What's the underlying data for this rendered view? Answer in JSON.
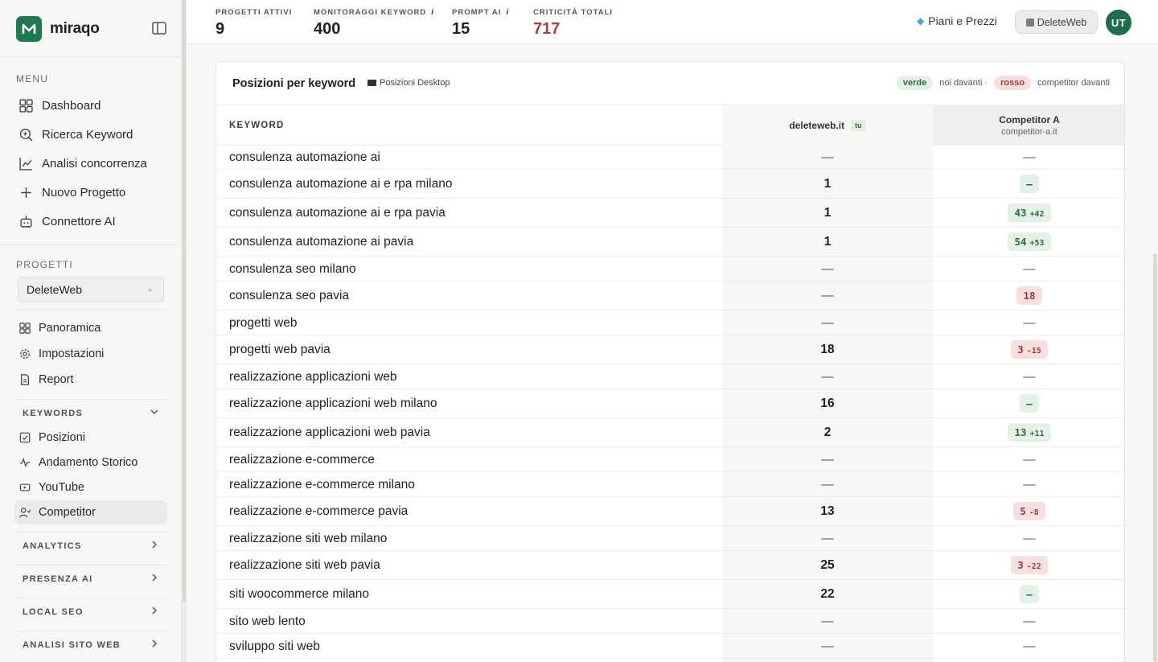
{
  "brand": {
    "name": "miraqo"
  },
  "sidebar": {
    "menu_label": "MENU",
    "menu": [
      {
        "label": "Dashboard",
        "icon": "grid-icon"
      },
      {
        "label": "Ricerca Keyword",
        "icon": "search-icon"
      },
      {
        "label": "Analisi concorrenza",
        "icon": "line-chart-icon"
      },
      {
        "label": "Nuovo Progetto",
        "icon": "plus-icon"
      },
      {
        "label": "Connettore AI",
        "icon": "bot-icon"
      }
    ],
    "projects_label": "PROGETTI",
    "selected_project": "DeleteWeb",
    "project_nav": [
      {
        "label": "Panoramica",
        "icon": "grid-icon"
      },
      {
        "label": "Impostazioni",
        "icon": "gear-icon"
      },
      {
        "label": "Report",
        "icon": "document-icon"
      }
    ],
    "keywords_group": "KEYWORDS",
    "keywords_items": [
      {
        "label": "Posizioni",
        "icon": "checkbox-icon"
      },
      {
        "label": "Andamento Storico",
        "icon": "pulse-icon"
      },
      {
        "label": "YouTube",
        "icon": "youtube-icon"
      },
      {
        "label": "Competitor",
        "icon": "users-icon"
      }
    ],
    "groups": [
      "ANALYTICS",
      "PRESENZA AI",
      "LOCAL SEO",
      "ANALISI SITO WEB"
    ]
  },
  "topbar": {
    "stats": [
      {
        "label": "PROGETTI ATTIVI",
        "value": "9",
        "info": ""
      },
      {
        "label": "MONITORAGGI KEYWORD",
        "value": "400",
        "info": "i"
      },
      {
        "label": "PROMPT AI",
        "value": "15",
        "info": "i"
      },
      {
        "label": "CRITICITÀ TOTALI",
        "value": "717",
        "info": ""
      }
    ],
    "plans_label": "Piani e Prezzi",
    "project_button": "DeleteWeb",
    "avatar_initials": "UT"
  },
  "card": {
    "title": "Posizioni per keyword",
    "desktop_badge": "Posizioni Desktop",
    "legend": {
      "green": "verde",
      "green_text": "noi davanti ·",
      "red": "rosso",
      "red_text": "competitor davanti"
    },
    "columns": {
      "keyword": "KEYWORD",
      "own_domain": "deleteweb.it",
      "own_tag": "tu",
      "competitor_name": "Competitor A",
      "competitor_domain": "competitor-a.it"
    }
  },
  "colors": {
    "accent": "#1d7a4f",
    "green_badge": "#e5f1e7",
    "red_badge": "#f8e0e0",
    "critical": "#b43a3a"
  },
  "rows": [
    {
      "keyword": "consulenza automazione ai",
      "own": "—",
      "comp": "—",
      "delta": "",
      "tone": ""
    },
    {
      "keyword": "consulenza automazione ai e rpa milano",
      "own": "1",
      "comp": "–",
      "delta": "",
      "tone": "g"
    },
    {
      "keyword": "consulenza automazione ai e rpa pavia",
      "own": "1",
      "comp": "43",
      "delta": "+42",
      "tone": "g"
    },
    {
      "keyword": "consulenza automazione ai pavia",
      "own": "1",
      "comp": "54",
      "delta": "+53",
      "tone": "g"
    },
    {
      "keyword": "consulenza seo milano",
      "own": "—",
      "comp": "—",
      "delta": "",
      "tone": ""
    },
    {
      "keyword": "consulenza seo pavia",
      "own": "—",
      "comp": "18",
      "delta": "",
      "tone": "r"
    },
    {
      "keyword": "progetti web",
      "own": "—",
      "comp": "—",
      "delta": "",
      "tone": ""
    },
    {
      "keyword": "progetti web pavia",
      "own": "18",
      "comp": "3",
      "delta": "-15",
      "tone": "r"
    },
    {
      "keyword": "realizzazione applicazioni web",
      "own": "—",
      "comp": "—",
      "delta": "",
      "tone": ""
    },
    {
      "keyword": "realizzazione applicazioni web milano",
      "own": "16",
      "comp": "–",
      "delta": "",
      "tone": "g"
    },
    {
      "keyword": "realizzazione applicazioni web pavia",
      "own": "2",
      "comp": "13",
      "delta": "+11",
      "tone": "g"
    },
    {
      "keyword": "realizzazione e-commerce",
      "own": "—",
      "comp": "—",
      "delta": "",
      "tone": ""
    },
    {
      "keyword": "realizzazione e-commerce milano",
      "own": "—",
      "comp": "—",
      "delta": "",
      "tone": ""
    },
    {
      "keyword": "realizzazione e-commerce pavia",
      "own": "13",
      "comp": "5",
      "delta": "-8",
      "tone": "r"
    },
    {
      "keyword": "realizzazione siti web milano",
      "own": "—",
      "comp": "—",
      "delta": "",
      "tone": ""
    },
    {
      "keyword": "realizzazione siti web pavia",
      "own": "25",
      "comp": "3",
      "delta": "-22",
      "tone": "r"
    },
    {
      "keyword": "siti woocommerce milano",
      "own": "22",
      "comp": "–",
      "delta": "",
      "tone": "g"
    },
    {
      "keyword": "sito web lento",
      "own": "—",
      "comp": "—",
      "delta": "",
      "tone": ""
    },
    {
      "keyword": "sviluppo siti web",
      "own": "—",
      "comp": "—",
      "delta": "",
      "tone": ""
    }
  ]
}
